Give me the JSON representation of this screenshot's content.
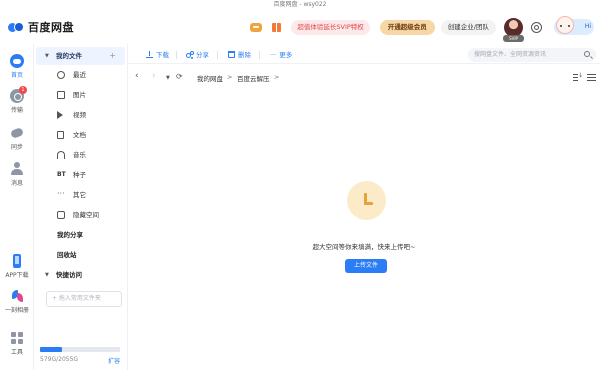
{
  "window": {
    "title": "百度网盘 - wsy022"
  },
  "app": {
    "logo_text": "百度网盘"
  },
  "header": {
    "svip_promo": "超值体验延长SVIP特权",
    "open_member": "开通超级会员",
    "enterprise": "创建企业/团队",
    "user_tag": "SVIP",
    "mascot_text": "Hi"
  },
  "leftnav": {
    "items": [
      {
        "label": "首页",
        "icon": "home-icon"
      },
      {
        "label": "传输",
        "icon": "transfer-icon",
        "badge": "1"
      },
      {
        "label": "同步",
        "icon": "sync-icon"
      },
      {
        "label": "消息",
        "icon": "message-icon"
      },
      {
        "label": "APP下载",
        "icon": "phone-icon"
      },
      {
        "label": "一刻相册",
        "icon": "pinwheel-icon"
      },
      {
        "label": "工具",
        "icon": "tools-icon"
      }
    ]
  },
  "sidebar": {
    "my_files": "我的文件",
    "categories": [
      {
        "label": "最近",
        "icon": "clock-icon"
      },
      {
        "label": "图片",
        "icon": "image-icon"
      },
      {
        "label": "视频",
        "icon": "video-icon"
      },
      {
        "label": "文档",
        "icon": "document-icon"
      },
      {
        "label": "音乐",
        "icon": "music-icon"
      },
      {
        "label": "种子",
        "icon": "torrent-icon",
        "glyph": "BT"
      },
      {
        "label": "其它",
        "icon": "more-dots-icon",
        "glyph": "···"
      },
      {
        "label": "隐藏空间",
        "icon": "lock-icon"
      }
    ],
    "my_share": "我的分享",
    "recycle": "回收站",
    "quick_access": "快捷访问",
    "quick_placeholder": "+ 拖入常用文件夹",
    "quota_text": "579G/2055G",
    "quota_used_fraction": 0.28,
    "expand": "扩容"
  },
  "toolbar": {
    "upload": "下载",
    "share": "分享",
    "delete": "删除",
    "more": "更多",
    "search_placeholder": "搜网盘文件、全网资源资讯"
  },
  "path": {
    "crumbs": [
      "我的网盘",
      ">",
      "百度云解压",
      ">"
    ]
  },
  "empty": {
    "message": "超大空间等你来填满，快来上传吧~",
    "upload_button": "上传文件"
  },
  "colors": {
    "accent": "#2a7df5",
    "badge": "#f04a4a"
  }
}
